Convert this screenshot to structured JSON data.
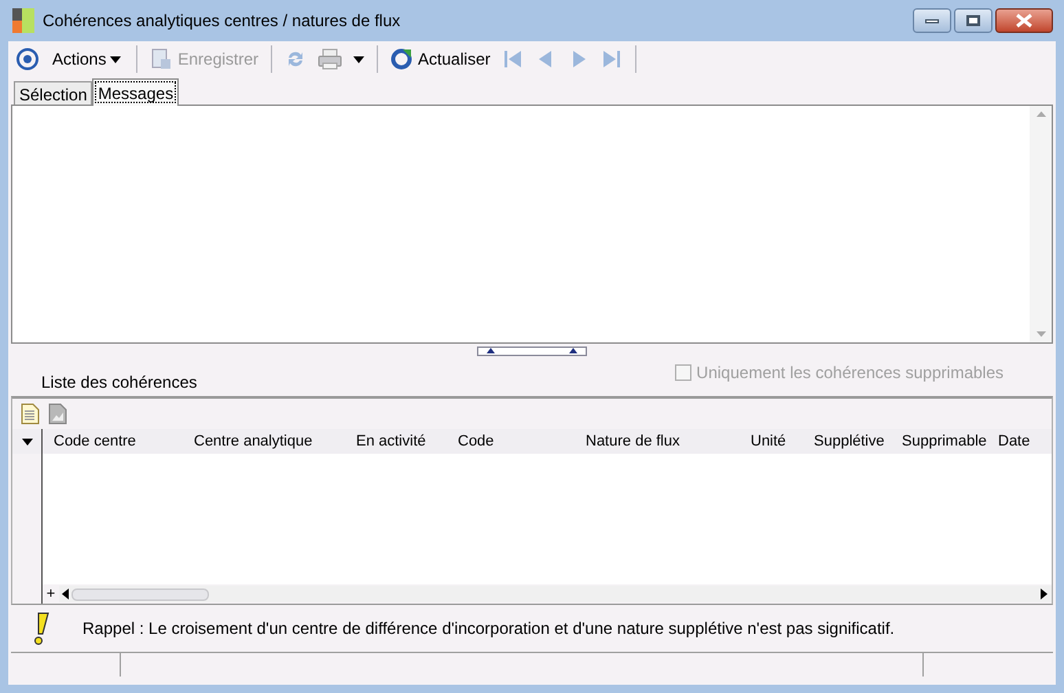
{
  "window": {
    "title": "Cohérences analytiques centres / natures de flux"
  },
  "toolbar": [
    {
      "kind": "target"
    },
    {
      "kind": "menu",
      "label": "Actions",
      "disabled": false
    },
    {
      "kind": "separator"
    },
    {
      "kind": "save",
      "label": "Enregistrer",
      "disabled": true
    },
    {
      "kind": "separator"
    },
    {
      "kind": "sync",
      "disabled": true
    },
    {
      "kind": "print"
    },
    {
      "kind": "dropdown"
    },
    {
      "kind": "separator"
    },
    {
      "kind": "refresh",
      "label": "Actualiser",
      "disabled": false
    },
    {
      "kind": "first",
      "disabled": true
    },
    {
      "kind": "prev",
      "disabled": true
    },
    {
      "kind": "next",
      "disabled": true
    },
    {
      "kind": "last",
      "disabled": true
    },
    {
      "kind": "separator"
    }
  ],
  "tabs": [
    {
      "label": "Sélection",
      "selected": false
    },
    {
      "label": "Messages",
      "selected": true
    }
  ],
  "list": {
    "title": "Liste des cohérences",
    "filter": {
      "label": "Uniquement les cohérences supprimables",
      "checked": false,
      "disabled": true
    }
  },
  "table": {
    "columns": [
      "Code centre",
      "Centre analytique",
      "En activité",
      "Code",
      "Nature de flux",
      "Unité",
      "Supplétive",
      "Supprimable",
      "Date"
    ],
    "add_label": "+"
  },
  "note": "Rappel : Le croisement d'un centre de différence d'incorporation et d'une nature supplétive n'est pas significatif."
}
